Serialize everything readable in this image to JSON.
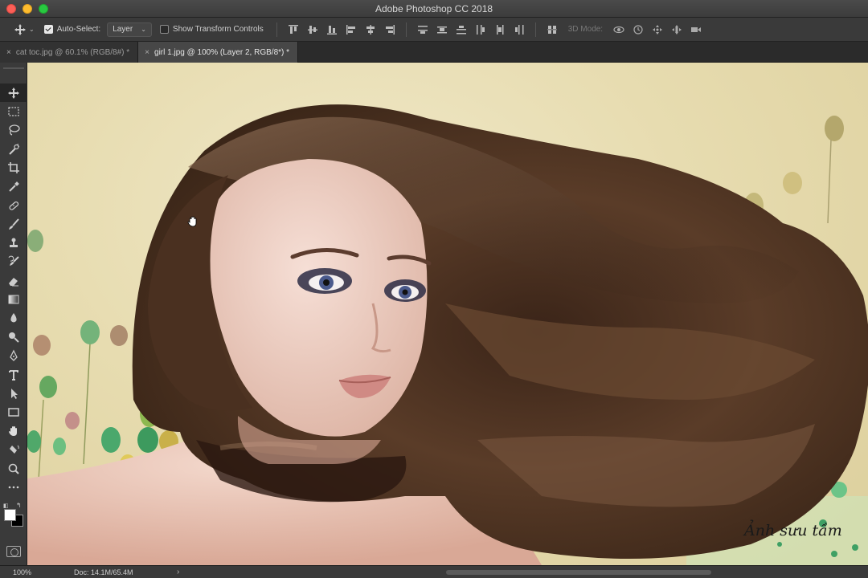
{
  "window": {
    "title": "Adobe Photoshop CC 2018"
  },
  "options_bar": {
    "tool_icon": "move-icon",
    "auto_select_label": "Auto-Select:",
    "auto_select_checked": true,
    "auto_select_target": "Layer",
    "show_transform_label": "Show Transform Controls",
    "show_transform_checked": false,
    "mode_3d_label": "3D Mode:"
  },
  "tabs": [
    {
      "label": "cat toc.jpg @ 60.1% (RGB/8#) *",
      "active": false
    },
    {
      "label": "girl 1.jpg @ 100% (Layer 2, RGB/8*) *",
      "active": true
    }
  ],
  "toolbox": {
    "tools": [
      "move-tool",
      "marquee-tool",
      "lasso-tool",
      "quick-selection-tool",
      "crop-tool",
      "eyedropper-tool",
      "healing-brush-tool",
      "brush-tool",
      "clone-stamp-tool",
      "history-brush-tool",
      "eraser-tool",
      "gradient-tool",
      "blur-tool",
      "dodge-tool",
      "pen-tool",
      "type-tool",
      "path-selection-tool",
      "rectangle-tool",
      "hand-tool",
      "rotate-view-tool",
      "zoom-tool",
      "more-tools"
    ],
    "foreground_color": "#ffffff",
    "background_color": "#000000"
  },
  "canvas": {
    "watermark": "Ảnh sưu tầm"
  },
  "status_bar": {
    "zoom": "100%",
    "doc_info": "Doc: 14.1M/65.4M",
    "arrow": "›"
  }
}
